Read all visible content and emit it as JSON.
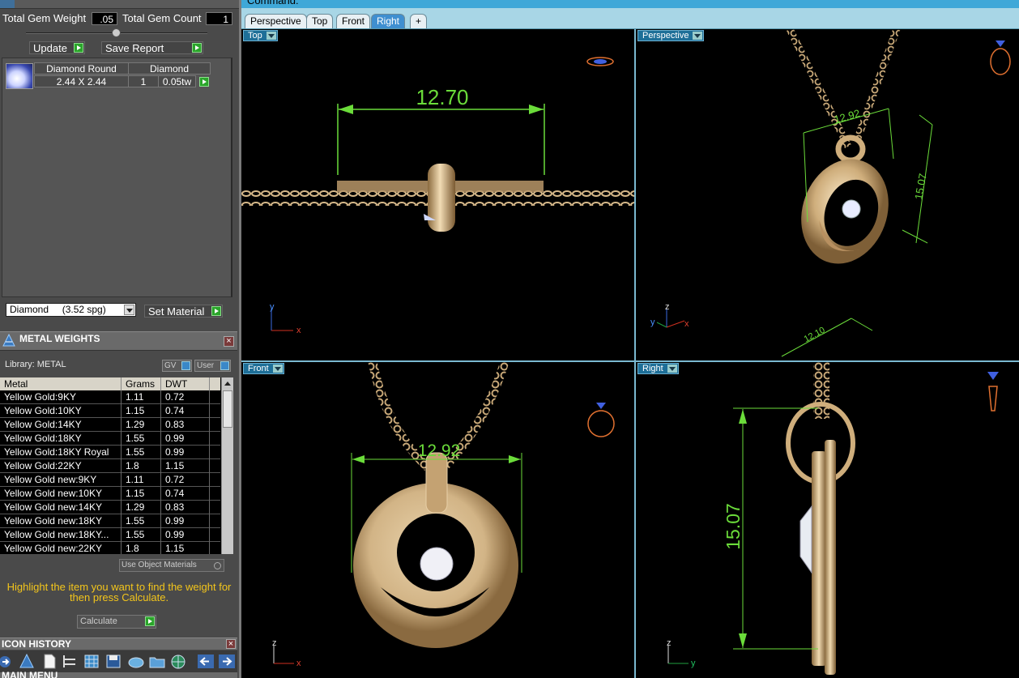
{
  "gem_panel": {
    "total_weight_label": "Total Gem Weight",
    "total_weight_value": ".05",
    "total_count_label": "Total Gem Count",
    "total_count_value": "1",
    "update_label": "Update",
    "save_report_label": "Save Report",
    "gem": {
      "shape": "Diamond Round",
      "material": "Diamond",
      "size": "2.44 X 2.44",
      "count": "1",
      "weight": "0.05tw"
    },
    "material_select": "Diamond     (3.52 spg)",
    "set_material_label": "Set Material"
  },
  "metal_weights": {
    "title": "METAL WEIGHTS",
    "library_label": "Library: METAL",
    "gv_label": "GV",
    "user_label": "User",
    "columns": [
      "Metal",
      "Grams",
      "DWT"
    ],
    "rows": [
      {
        "metal": "Yellow Gold:9KY",
        "grams": "1.11",
        "dwt": "0.72"
      },
      {
        "metal": "Yellow Gold:10KY",
        "grams": "1.15",
        "dwt": "0.74"
      },
      {
        "metal": "Yellow Gold:14KY",
        "grams": "1.29",
        "dwt": "0.83"
      },
      {
        "metal": "Yellow Gold:18KY",
        "grams": "1.55",
        "dwt": "0.99"
      },
      {
        "metal": "Yellow Gold:18KY Royal",
        "grams": "1.55",
        "dwt": "0.99"
      },
      {
        "metal": "Yellow Gold:22KY",
        "grams": "1.8",
        "dwt": "1.15"
      },
      {
        "metal": "Yellow Gold new:9KY",
        "grams": "1.11",
        "dwt": "0.72"
      },
      {
        "metal": "Yellow Gold new:10KY",
        "grams": "1.15",
        "dwt": "0.74"
      },
      {
        "metal": "Yellow Gold new:14KY",
        "grams": "1.29",
        "dwt": "0.83"
      },
      {
        "metal": "Yellow Gold new:18KY",
        "grams": "1.55",
        "dwt": "0.99"
      },
      {
        "metal": "Yellow Gold new:18KY...",
        "grams": "1.55",
        "dwt": "0.99"
      },
      {
        "metal": "Yellow Gold new:22KY",
        "grams": "1.8",
        "dwt": "1.15"
      }
    ],
    "use_object_materials": "Use Object Materials",
    "hint": "Highlight the item you want to find the weight for then press Calculate.",
    "calculate_label": "Calculate"
  },
  "icon_history": {
    "title": "ICON HISTORY",
    "icons": [
      "arrow-icon",
      "gem-icon",
      "document-icon",
      "tree-icon",
      "grid-icon",
      "save-icon",
      "stone-icon",
      "folder-icon",
      "globe-icon",
      "back-icon",
      "forward-icon"
    ]
  },
  "main_menu": {
    "title": "MAIN MENU"
  },
  "command": {
    "label": "Command:"
  },
  "tabs": [
    "Perspective",
    "Top",
    "Front",
    "Right",
    "+"
  ],
  "active_tab": "Right",
  "viewports": {
    "top": {
      "label": "Top",
      "dimension": "12.70",
      "axis_a": "y",
      "axis_b": "x"
    },
    "perspective": {
      "label": "Perspective",
      "dim_width": "12.92",
      "dim_height": "15.07",
      "dim_depth": "12.10",
      "axis_a": "z",
      "axis_b": "y",
      "axis_c": "x"
    },
    "front": {
      "label": "Front",
      "dimension": "12.92",
      "axis_a": "z",
      "axis_b": "x"
    },
    "right": {
      "label": "Right",
      "dimension": "15.07",
      "axis_a": "z",
      "axis_b": "y"
    }
  },
  "colors": {
    "metal": "#d6b98a",
    "dimension": "#6bdc3a",
    "accent": "#3fa8d8",
    "hint": "#f3c51b"
  }
}
